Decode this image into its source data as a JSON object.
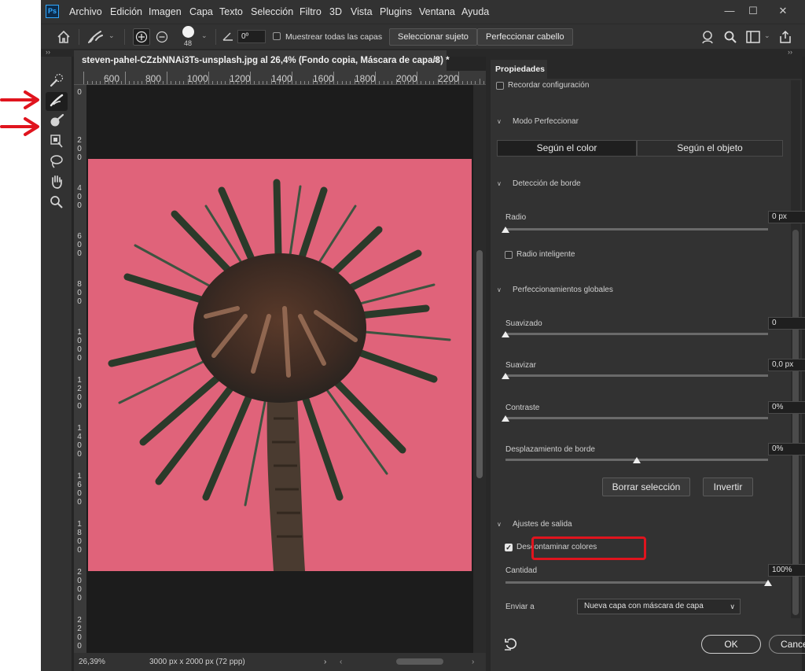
{
  "colors": {
    "annotation": "#e0141e",
    "photo_bg": "#e0637a",
    "accent": "#31a8ff"
  },
  "app": {
    "logo": "Ps"
  },
  "menu": [
    "Archivo",
    "Edición",
    "Imagen",
    "Capa",
    "Texto",
    "Selección",
    "Filtro",
    "3D",
    "Vista",
    "Plugins",
    "Ventana",
    "Ayuda"
  ],
  "options_bar": {
    "brush_size": "48",
    "angle": "0º",
    "sample_all_layers": "Muestrear todas las capas",
    "select_subject": "Seleccionar sujeto",
    "refine_hair": "Perfeccionar cabello"
  },
  "document": {
    "tab_title": "steven-pahel-CZzbNNAi3Ts-unsplash.jpg al 26,4% (Fondo copia, Máscara de capa/8) *",
    "ruler_top": [
      "600",
      "800",
      "1000",
      "1200",
      "1400",
      "1600",
      "1800",
      "2000",
      "2200"
    ],
    "ruler_left": [
      "0",
      "200",
      "400",
      "600",
      "800",
      "1000",
      "1200",
      "1400",
      "1600",
      "1800",
      "2000",
      "2200"
    ],
    "zoom": "26,39%",
    "doc_info": "3000 px x 2000 px (72 ppp)"
  },
  "properties": {
    "tab": "Propiedades",
    "remember_settings": "Recordar configuración",
    "refine_mode": {
      "title": "Modo Perfeccionar",
      "options": [
        "Según el color",
        "Según el objeto"
      ]
    },
    "edge_detection": {
      "title": "Detección de borde",
      "radius_label": "Radio",
      "radius_value": "0 px",
      "radius_fraction": 0.0,
      "smart_radius": "Radio inteligente"
    },
    "global_refinements": {
      "title": "Perfeccionamientos globales",
      "smooth_label": "Suavizado",
      "smooth_value": "0",
      "smooth_fraction": 0.0,
      "feather_label": "Suavizar",
      "feather_value": "0,0 px",
      "feather_fraction": 0.0,
      "contrast_label": "Contraste",
      "contrast_value": "0%",
      "contrast_fraction": 0.0,
      "shift_label": "Desplazamiento de borde",
      "shift_value": "0%",
      "shift_fraction": 0.5
    },
    "clear_selection": "Borrar selección",
    "invert": "Invertir",
    "output_settings": {
      "title": "Ajustes de salida",
      "decontaminate": "Descontaminar colores",
      "amount_label": "Cantidad",
      "amount_value": "100%",
      "amount_fraction": 1.0,
      "output_to_label": "Enviar a",
      "output_to_value": "Nueva capa con máscara de capa"
    },
    "ok": "OK",
    "cancel": "Cancelar"
  }
}
